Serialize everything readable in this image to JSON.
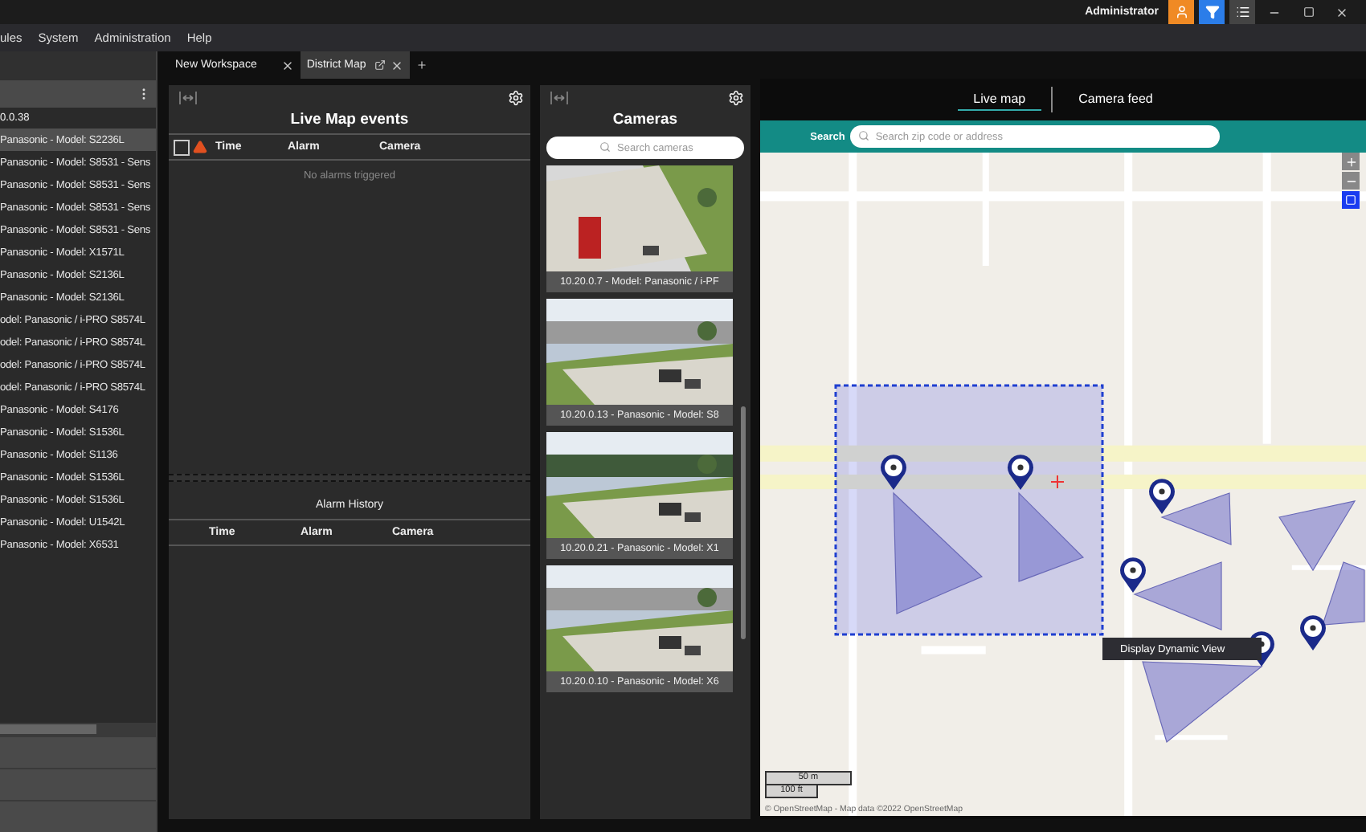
{
  "title_bar": {
    "user": "Administrator"
  },
  "menu": [
    "ules",
    "System",
    "Administration",
    "Help"
  ],
  "sidebar": {
    "header": "0.0.38",
    "items": [
      {
        "label": "Panasonic - Model: S2236L",
        "selected": true
      },
      {
        "label": "Panasonic - Model: S8531 - Sens",
        "selected": false
      },
      {
        "label": "Panasonic - Model: S8531 - Sens",
        "selected": false
      },
      {
        "label": "Panasonic - Model: S8531 - Sens",
        "selected": false
      },
      {
        "label": "Panasonic - Model: S8531 - Sens",
        "selected": false
      },
      {
        "label": "Panasonic - Model: X1571L",
        "selected": false
      },
      {
        "label": "Panasonic - Model: S2136L",
        "selected": false
      },
      {
        "label": "Panasonic - Model: S2136L",
        "selected": false
      },
      {
        "label": "odel: Panasonic / i-PRO S8574L",
        "selected": false
      },
      {
        "label": "odel: Panasonic / i-PRO S8574L",
        "selected": false
      },
      {
        "label": "odel: Panasonic / i-PRO S8574L",
        "selected": false
      },
      {
        "label": "odel: Panasonic / i-PRO S8574L",
        "selected": false
      },
      {
        "label": "Panasonic - Model: S4176",
        "selected": false
      },
      {
        "label": "Panasonic - Model: S1536L",
        "selected": false
      },
      {
        "label": "Panasonic - Model: S1136",
        "selected": false
      },
      {
        "label": "Panasonic - Model: S1536L",
        "selected": false
      },
      {
        "label": "Panasonic - Model: S1536L",
        "selected": false
      },
      {
        "label": "Panasonic - Model: U1542L",
        "selected": false
      },
      {
        "label": "Panasonic - Model: X6531",
        "selected": false
      }
    ]
  },
  "workspace_tabs": [
    {
      "label": "New Workspace",
      "selected": false,
      "popout": false
    },
    {
      "label": "District Map",
      "selected": true,
      "popout": true
    }
  ],
  "events_panel": {
    "title": "Live Map events",
    "columns": [
      "Time",
      "Alarm",
      "Camera"
    ],
    "select_all": {
      "checked": false
    },
    "empty_message": "No alarms triggered",
    "history": {
      "title": "Alarm History",
      "columns": [
        "Time",
        "Alarm",
        "Camera"
      ]
    }
  },
  "cameras_panel": {
    "title": "Cameras",
    "search": {
      "placeholder": "Search cameras"
    },
    "cameras": [
      {
        "caption": "10.20.0.7 - Model: Panasonic / i-PF"
      },
      {
        "caption": "10.20.0.13 - Panasonic - Model: S8"
      },
      {
        "caption": "10.20.0.21 - Panasonic - Model: X1"
      },
      {
        "caption": "10.20.0.10 - Panasonic - Model: X6"
      }
    ]
  },
  "map_panel": {
    "tabs": [
      {
        "label": "Live map",
        "selected": true
      },
      {
        "label": "Camera feed",
        "selected": false
      }
    ],
    "search": {
      "label": "Search",
      "placeholder": "Search zip code or address"
    },
    "tooltip": "Display Dynamic View",
    "scale": [
      "50 m",
      "100 ft"
    ],
    "attribution": "© OpenStreetMap - Map data ©2022 OpenStreetMap"
  }
}
